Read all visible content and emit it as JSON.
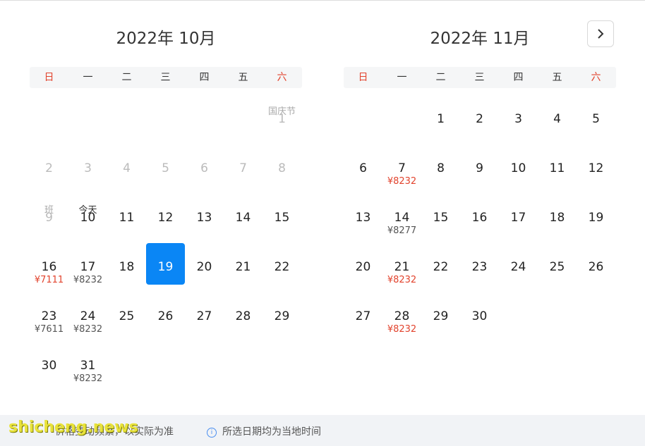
{
  "weekdays": [
    "日",
    "一",
    "二",
    "三",
    "四",
    "五",
    "六"
  ],
  "next_icon": "chevron-right-icon",
  "colors": {
    "accent": "#0a86f5",
    "weekend": "#e2432d",
    "low_price": "#e2432d",
    "footer_bg": "#f1f3f6",
    "watermark": "#e8e23a"
  },
  "months": [
    {
      "title": "2022年 10月",
      "days": [
        {
          "day": "1",
          "label": "国庆节",
          "label_gray": true,
          "past": true
        },
        {
          "day": "2",
          "past": true
        },
        {
          "day": "3",
          "past": true
        },
        {
          "day": "4",
          "past": true
        },
        {
          "day": "5",
          "past": true
        },
        {
          "day": "6",
          "past": true
        },
        {
          "day": "7",
          "past": true
        },
        {
          "day": "8",
          "past": true
        },
        {
          "day": "9",
          "label": "班",
          "label_gray": true,
          "past": true
        },
        {
          "day": "10",
          "label": "今天"
        },
        {
          "day": "11"
        },
        {
          "day": "12"
        },
        {
          "day": "13"
        },
        {
          "day": "14"
        },
        {
          "day": "15"
        },
        {
          "day": "16",
          "price": "¥7111",
          "low": true
        },
        {
          "day": "17",
          "price": "¥8232"
        },
        {
          "day": "18"
        },
        {
          "day": "19",
          "selected": true
        },
        {
          "day": "20"
        },
        {
          "day": "21"
        },
        {
          "day": "22"
        },
        {
          "day": "23",
          "price": "¥7611"
        },
        {
          "day": "24",
          "price": "¥8232"
        },
        {
          "day": "25"
        },
        {
          "day": "26"
        },
        {
          "day": "27"
        },
        {
          "day": "28"
        },
        {
          "day": "29"
        },
        {
          "day": "30"
        },
        {
          "day": "31",
          "price": "¥8232"
        }
      ]
    },
    {
      "title": "2022年 11月",
      "days": [
        {
          "day": "1"
        },
        {
          "day": "2"
        },
        {
          "day": "3"
        },
        {
          "day": "4"
        },
        {
          "day": "5"
        },
        {
          "day": "6"
        },
        {
          "day": "7",
          "price": "¥8232",
          "low": true
        },
        {
          "day": "8"
        },
        {
          "day": "9"
        },
        {
          "day": "10"
        },
        {
          "day": "11"
        },
        {
          "day": "12"
        },
        {
          "day": "13"
        },
        {
          "day": "14",
          "price": "¥8277"
        },
        {
          "day": "15"
        },
        {
          "day": "16"
        },
        {
          "day": "17"
        },
        {
          "day": "18"
        },
        {
          "day": "19"
        },
        {
          "day": "20"
        },
        {
          "day": "21",
          "price": "¥8232",
          "low": true
        },
        {
          "day": "22"
        },
        {
          "day": "23"
        },
        {
          "day": "24"
        },
        {
          "day": "25"
        },
        {
          "day": "26"
        },
        {
          "day": "27"
        },
        {
          "day": "28",
          "price": "¥8232",
          "low": true
        },
        {
          "day": "29"
        },
        {
          "day": "30"
        }
      ]
    }
  ],
  "footer": {
    "price_note": "价格变动频繁，以实际为准",
    "date_note": "所选日期均为当地时间",
    "info_icon": "info-icon"
  },
  "watermark": "shicheng.news"
}
